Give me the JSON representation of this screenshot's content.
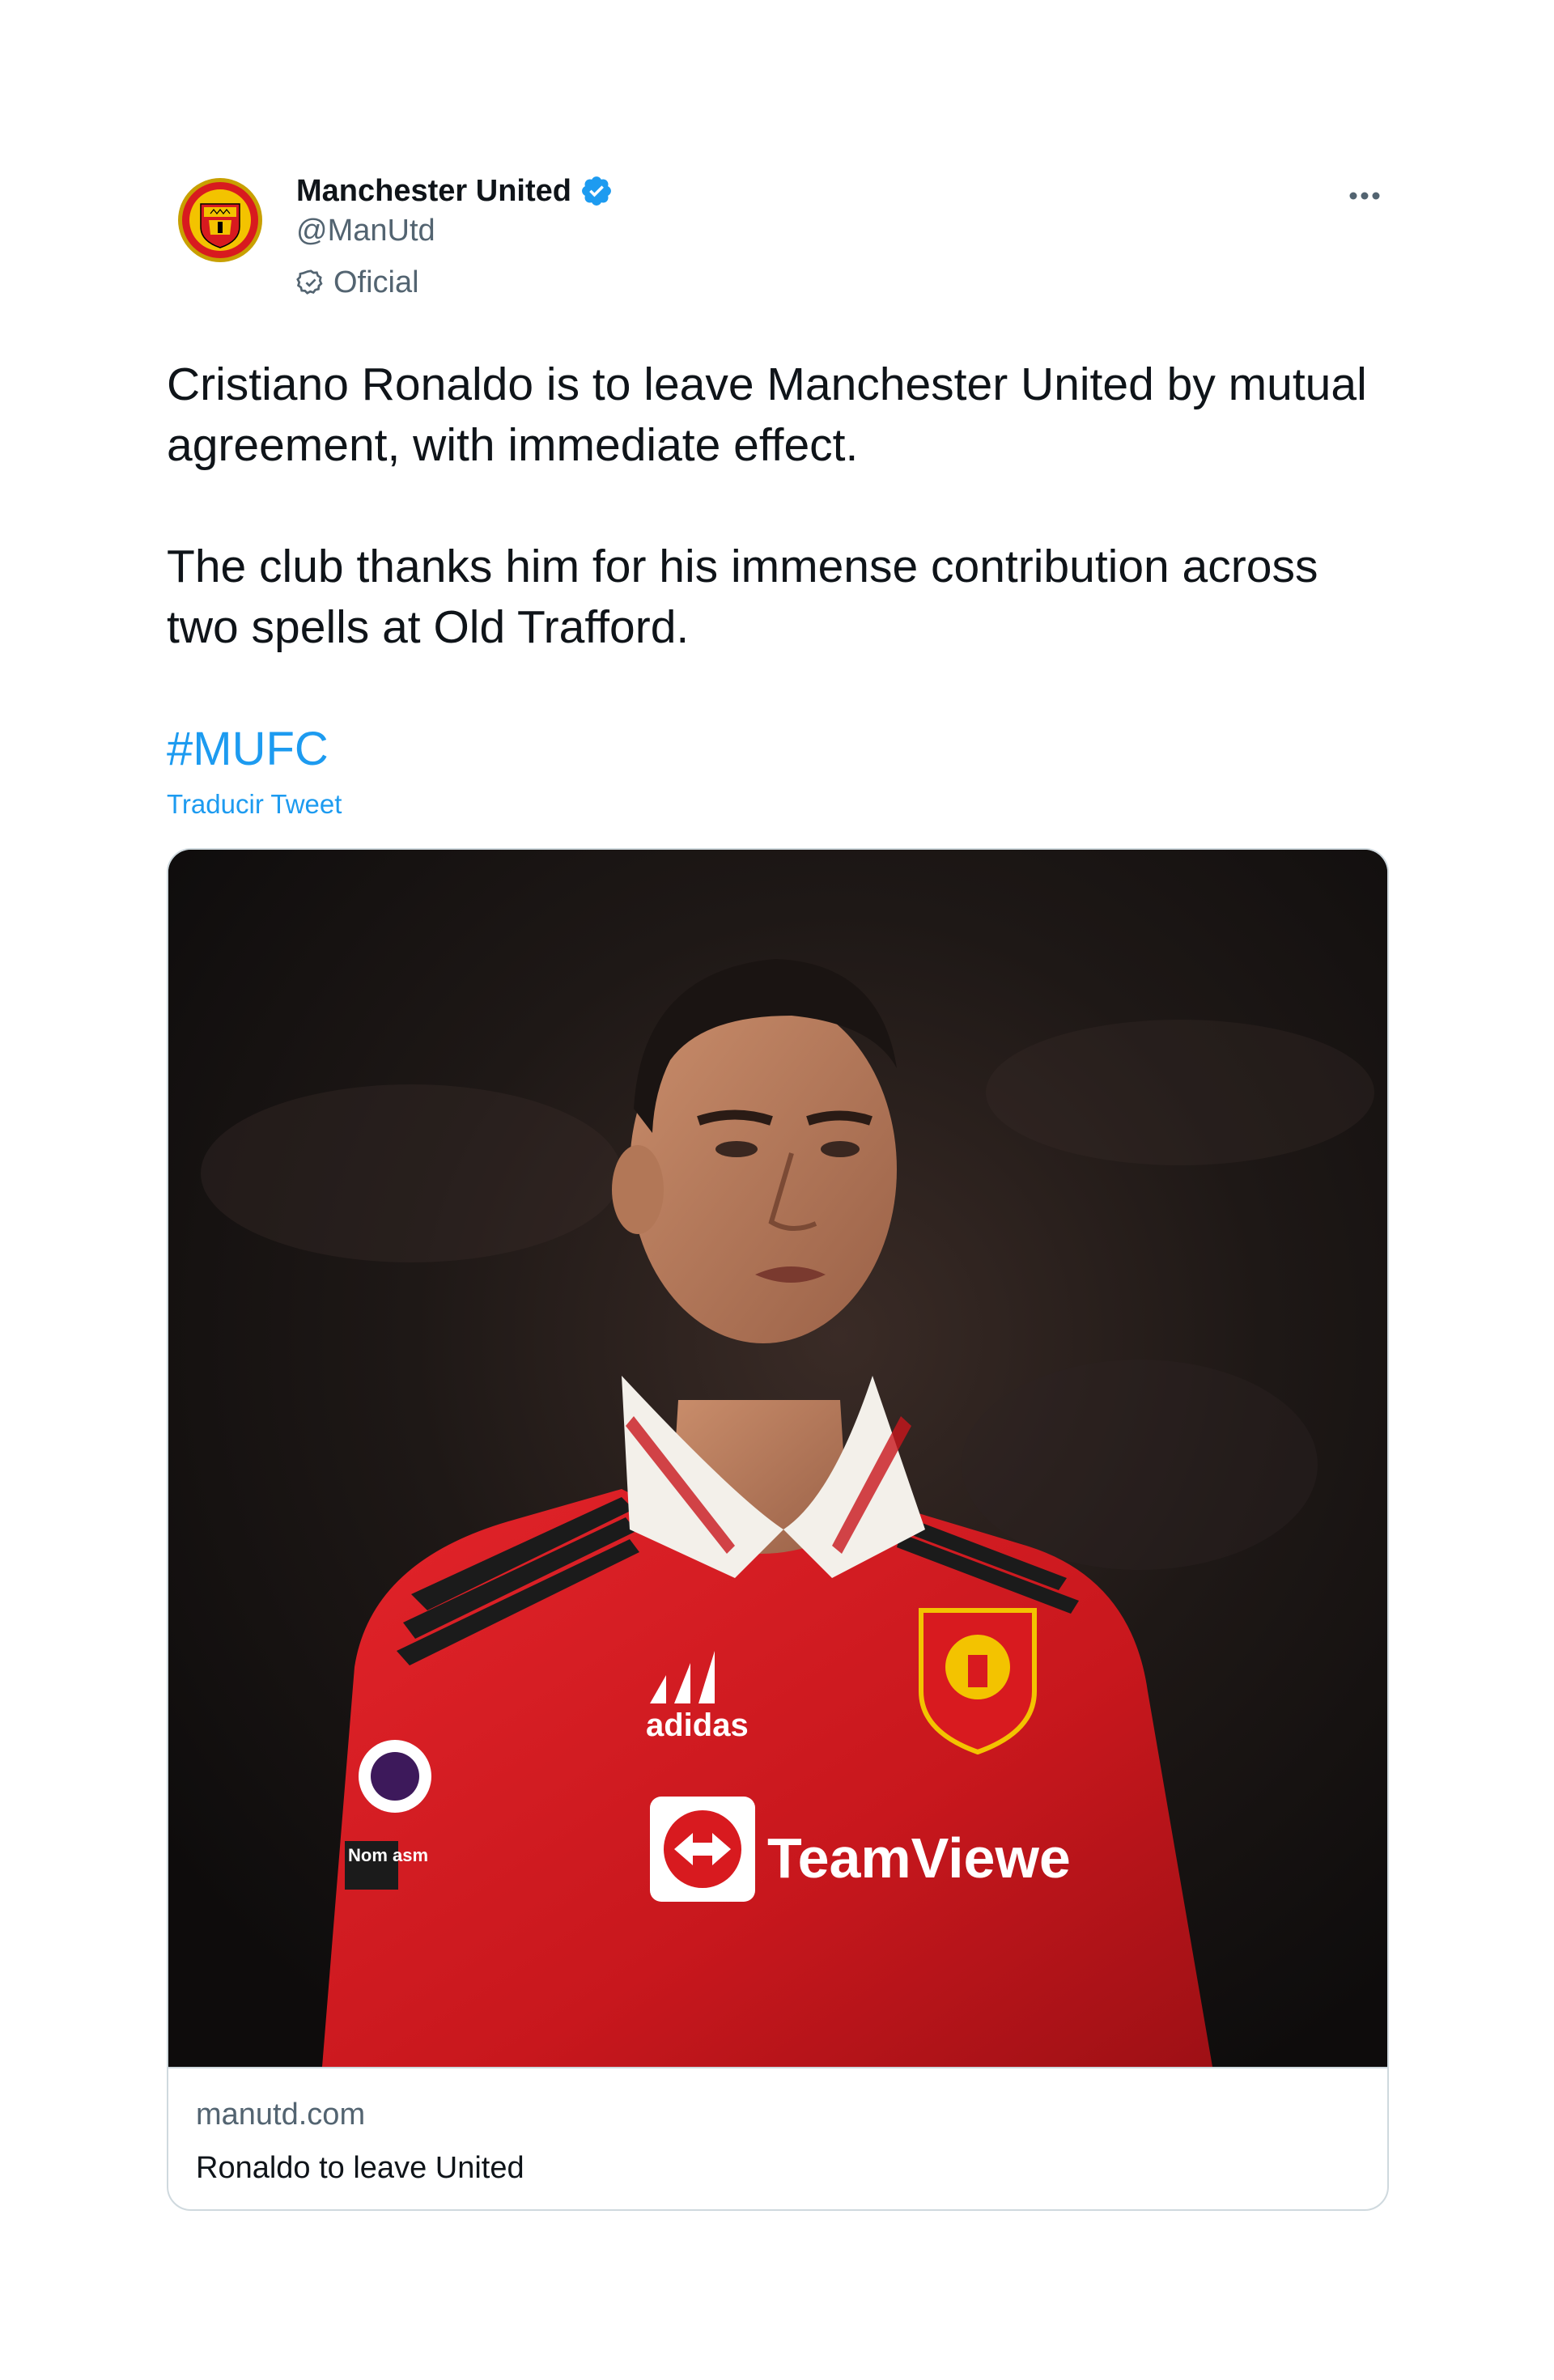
{
  "tweet": {
    "author": {
      "display_name": "Manchester United",
      "handle": "@ManUtd",
      "label": "Oficial",
      "verified": true
    },
    "text": {
      "paragraph_1": "Cristiano Ronaldo is to leave Manchester United by mutual agreement, with immediate effect.",
      "paragraph_2": "The club thanks him for his immense contribution across two spells at Old Trafford."
    },
    "hashtag": "#MUFC",
    "translate_label": "Traducir Tweet",
    "card": {
      "domain": "manutd.com",
      "title": "Ronaldo to leave United",
      "image_text": {
        "sponsor": "TeamViewe",
        "kit_brand": "adidas",
        "sleeve_sponsor": "Nom asm"
      }
    }
  },
  "icons": {
    "verified": "verified-badge-icon",
    "official": "official-check-icon",
    "more": "more-options-icon",
    "avatar": "manchester-united-crest"
  },
  "colors": {
    "accent": "#1d9bf0",
    "secondary_text": "#536471",
    "primary_text": "#0f1419",
    "border": "#cfd9de",
    "kit_red": "#d81a1f"
  }
}
